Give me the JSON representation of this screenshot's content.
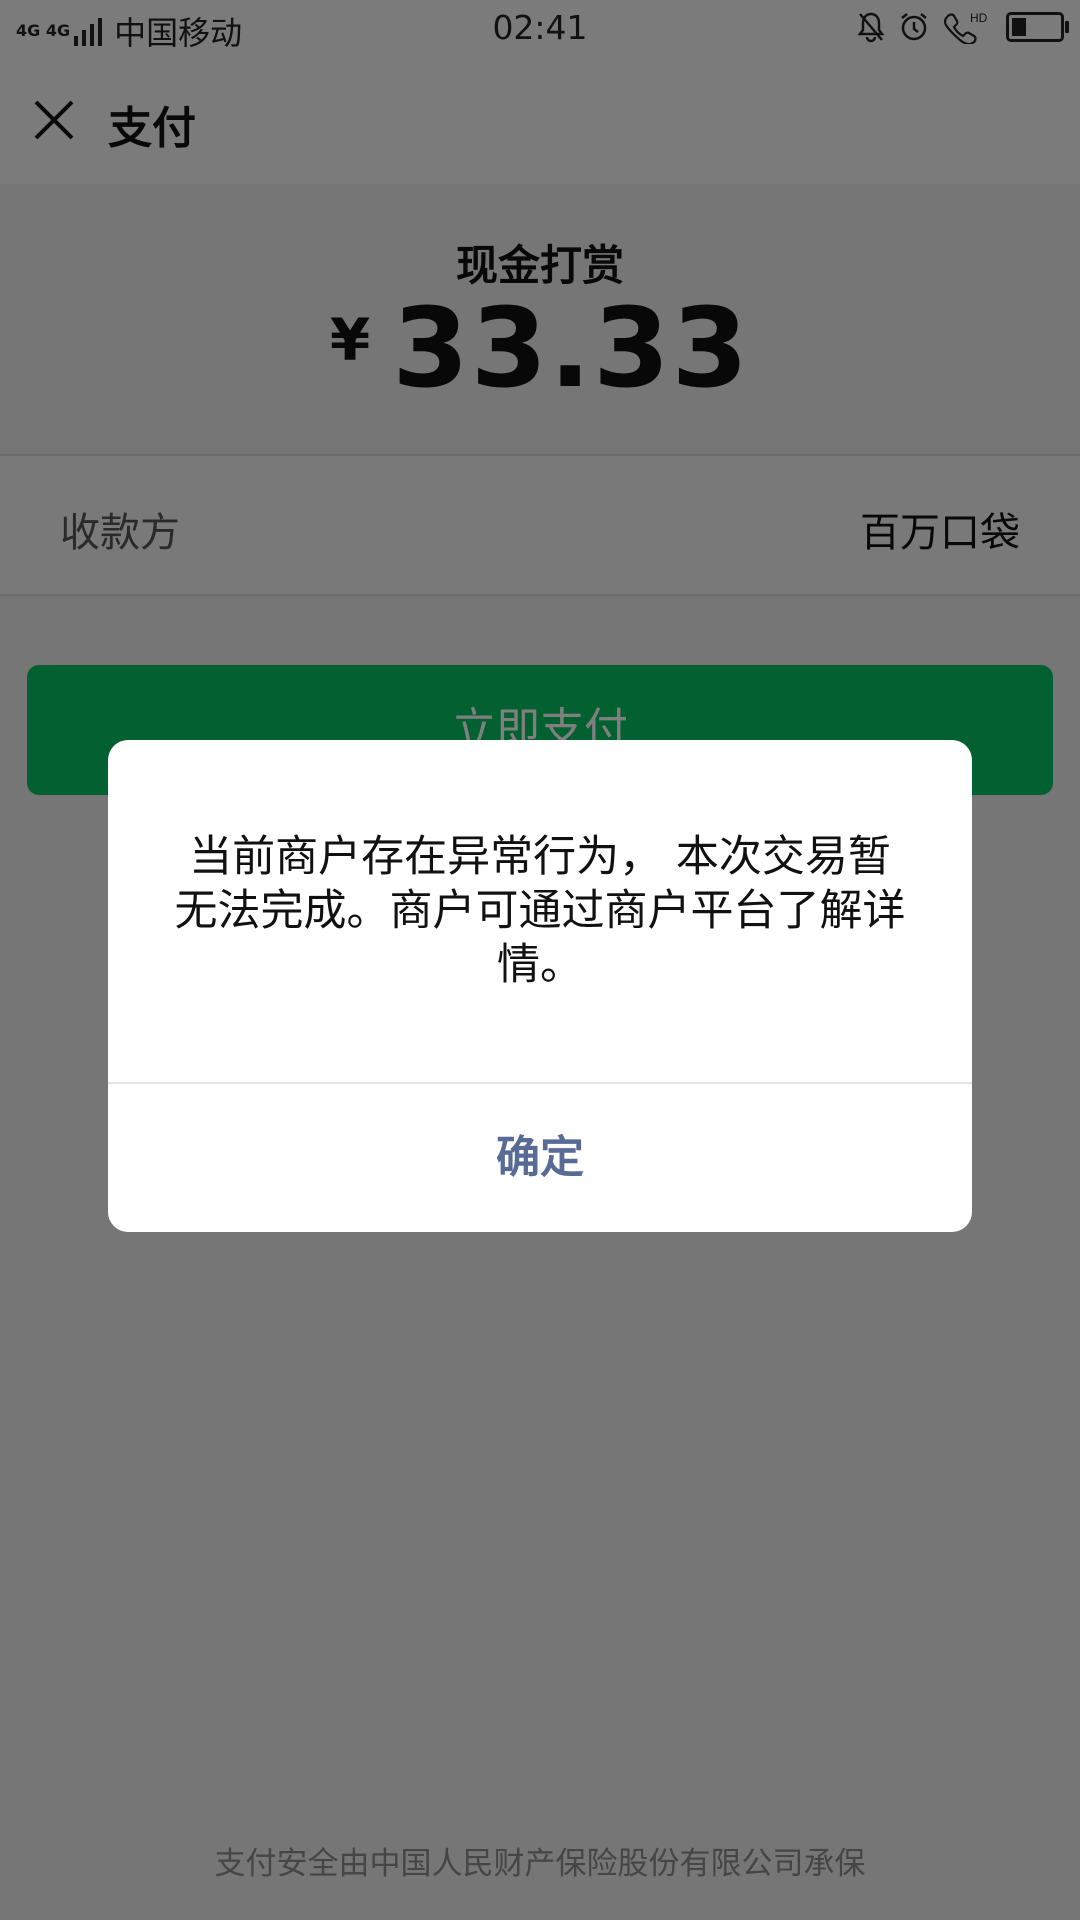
{
  "status_bar": {
    "network": "4G 4G",
    "carrier": "中国移动",
    "time": "02:41",
    "icons": [
      "bell-icon",
      "alarm-icon",
      "hd-call-icon",
      "battery-icon"
    ],
    "hd_label": "HD"
  },
  "header": {
    "title": "支付",
    "close_icon": "close-icon"
  },
  "payment": {
    "label": "现金打赏",
    "currency": "¥",
    "amount": "33.33",
    "payee_label": "收款方",
    "payee_value": "百万口袋",
    "pay_button": "立即支付"
  },
  "footer": {
    "note": "支付安全由中国人民财产保险股份有限公司承保"
  },
  "dialog": {
    "message": "当前商户存在异常行为， 本次交易暂无法完成。商户可通过商户平台了解详情。",
    "confirm": "确定"
  },
  "colors": {
    "accent_green": "#07c160",
    "dialog_link": "#576b95"
  }
}
